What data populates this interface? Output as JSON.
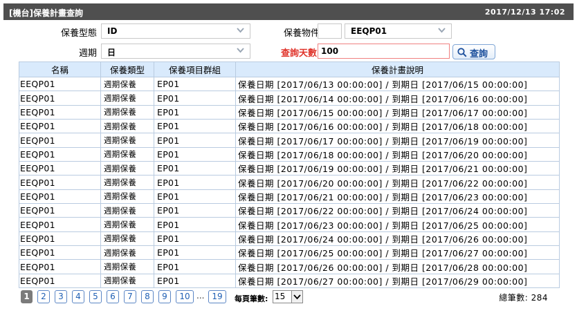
{
  "window": {
    "title": "[機台]保養計畫查詢",
    "datetime": "2017/12/13 17:02"
  },
  "form": {
    "type_label": "保養型態",
    "type_value": "ID",
    "object_label": "保養物件",
    "object_code": "",
    "object_value": "EEQP01",
    "cycle_label": "週期",
    "cycle_value": "日",
    "days_label": "查詢天數",
    "days_value": "100",
    "query_button": "查詢"
  },
  "table": {
    "columns": [
      "名稱",
      "保養類型",
      "保養項目群組",
      "保養計畫說明"
    ],
    "rows": [
      [
        "EEQP01",
        "週期保養",
        "EP01",
        "保養日期 [2017/06/13 00:00:00] / 到期日 [2017/06/15 00:00:00]"
      ],
      [
        "EEQP01",
        "週期保養",
        "EP01",
        "保養日期 [2017/06/14 00:00:00] / 到期日 [2017/06/16 00:00:00]"
      ],
      [
        "EEQP01",
        "週期保養",
        "EP01",
        "保養日期 [2017/06/15 00:00:00] / 到期日 [2017/06/17 00:00:00]"
      ],
      [
        "EEQP01",
        "週期保養",
        "EP01",
        "保養日期 [2017/06/16 00:00:00] / 到期日 [2017/06/18 00:00:00]"
      ],
      [
        "EEQP01",
        "週期保養",
        "EP01",
        "保養日期 [2017/06/17 00:00:00] / 到期日 [2017/06/19 00:00:00]"
      ],
      [
        "EEQP01",
        "週期保養",
        "EP01",
        "保養日期 [2017/06/18 00:00:00] / 到期日 [2017/06/20 00:00:00]"
      ],
      [
        "EEQP01",
        "週期保養",
        "EP01",
        "保養日期 [2017/06/19 00:00:00] / 到期日 [2017/06/21 00:00:00]"
      ],
      [
        "EEQP01",
        "週期保養",
        "EP01",
        "保養日期 [2017/06/20 00:00:00] / 到期日 [2017/06/22 00:00:00]"
      ],
      [
        "EEQP01",
        "週期保養",
        "EP01",
        "保養日期 [2017/06/21 00:00:00] / 到期日 [2017/06/23 00:00:00]"
      ],
      [
        "EEQP01",
        "週期保養",
        "EP01",
        "保養日期 [2017/06/22 00:00:00] / 到期日 [2017/06/24 00:00:00]"
      ],
      [
        "EEQP01",
        "週期保養",
        "EP01",
        "保養日期 [2017/06/23 00:00:00] / 到期日 [2017/06/25 00:00:00]"
      ],
      [
        "EEQP01",
        "週期保養",
        "EP01",
        "保養日期 [2017/06/24 00:00:00] / 到期日 [2017/06/26 00:00:00]"
      ],
      [
        "EEQP01",
        "週期保養",
        "EP01",
        "保養日期 [2017/06/25 00:00:00] / 到期日 [2017/06/27 00:00:00]"
      ],
      [
        "EEQP01",
        "週期保養",
        "EP01",
        "保養日期 [2017/06/26 00:00:00] / 到期日 [2017/06/28 00:00:00]"
      ],
      [
        "EEQP01",
        "週期保養",
        "EP01",
        "保養日期 [2017/06/27 00:00:00] / 到期日 [2017/06/29 00:00:00]"
      ]
    ]
  },
  "pager": {
    "pages": [
      "1",
      "2",
      "3",
      "4",
      "5",
      "6",
      "7",
      "8",
      "9",
      "10"
    ],
    "current": "1",
    "ellipsis": "...",
    "last_page": "19",
    "per_page_label": "每頁筆數:",
    "per_page_value": "15",
    "total_text": "總筆數: 284"
  },
  "colors": {
    "titlebar": "#4f4f4f",
    "header_bg": "#d9eafc",
    "accent_blue": "#1f5fb4",
    "warning_red": "#e0342b"
  },
  "icons": {
    "dropdown": "chevron-down-icon",
    "query": "search-icon"
  }
}
